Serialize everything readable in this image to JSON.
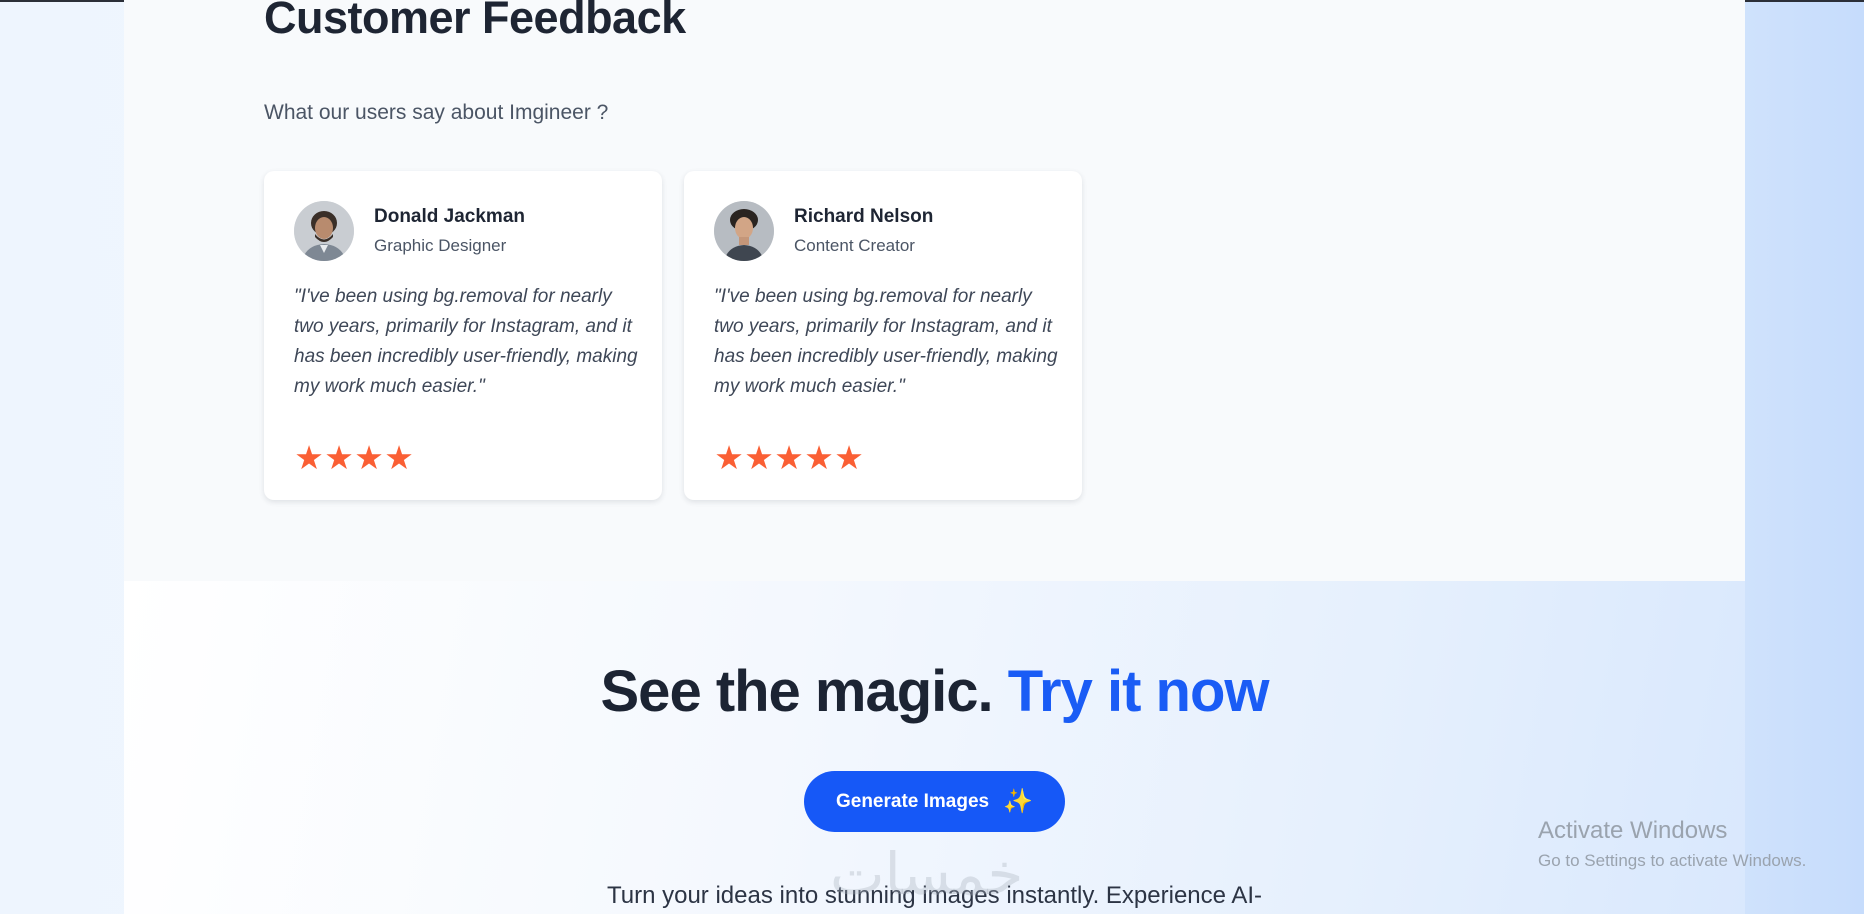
{
  "feedback": {
    "title": "Customer Feedback",
    "subtitle": "What our users say about Imgineer ?",
    "testimonials": [
      {
        "name": "Donald Jackman",
        "role": "Graphic Designer",
        "quote": "\"I've been using bg.removal for nearly two years, primarily for Instagram, and it has been incredibly user-friendly, making my work much easier.\"",
        "rating": 4
      },
      {
        "name": "Richard Nelson",
        "role": "Content Creator",
        "quote": "\"I've been using bg.removal for nearly two years, primarily for Instagram, and it has been incredibly user-friendly, making my work much easier.\"",
        "rating": 5
      }
    ],
    "star_glyph": "★",
    "star_color": "#fa5f34"
  },
  "cta": {
    "title_part1": "See the magic.",
    "title_part2": "Try it now",
    "highlight_color": "#1a5cf5",
    "button_label": "Generate Images",
    "button_icon": "sparkles-icon",
    "button_color": "#1658f7",
    "description": "Turn your ideas into stunning images instantly. Experience AI-"
  },
  "overlay": {
    "arabic_watermark": "خمسات",
    "windows_line1": "Activate Windows",
    "windows_line2": "Go to Settings to activate Windows."
  }
}
